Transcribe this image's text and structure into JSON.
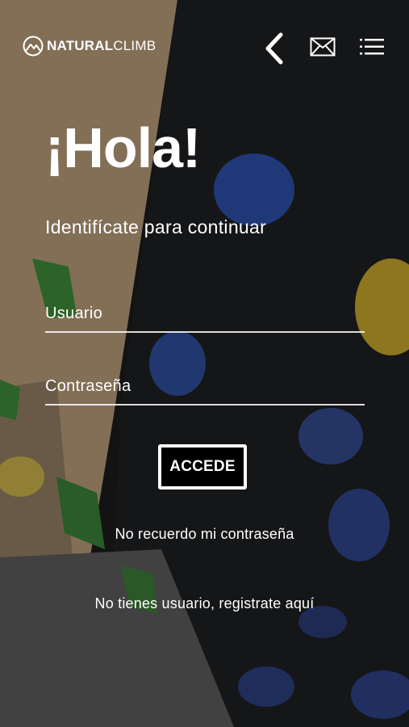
{
  "brand": {
    "bold": "NATURAL",
    "light": "CLIMB"
  },
  "header": {
    "back_icon": "chevron-left-icon",
    "mail_icon": "mail-icon",
    "menu_icon": "menu-list-icon"
  },
  "main": {
    "title": "¡Hola!",
    "subtitle": "Identifícate para continuar",
    "username_placeholder": "Usuario",
    "password_placeholder": "Contraseña",
    "login_button": "ACCEDE",
    "forgot_link": "No recuerdo mi contraseña",
    "register_link": "No tienes usuario, registrate aquí"
  },
  "colors": {
    "button_bg": "#000000",
    "text": "#ffffff",
    "wall": "#1b1b1d"
  }
}
